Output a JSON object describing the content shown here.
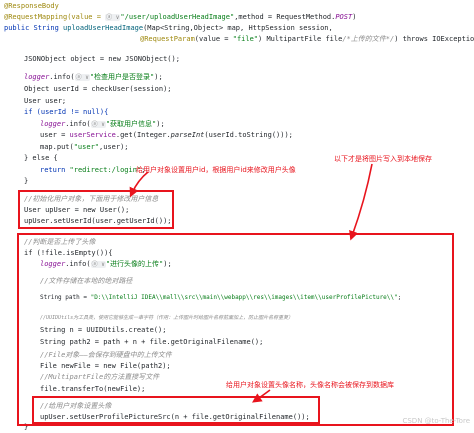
{
  "code": {
    "l01": "@ResponseBody",
    "l02a": "@RequestMapping(value = ",
    "l02b": "\"/user/uploadUserHeadImage\"",
    "l02c": ",method = RequestMethod.",
    "l02d": "POST",
    "l02e": ")",
    "l03a": "public String ",
    "l03b": "uploadUserHeadImage",
    "l03c": "(Map<String,Object> map, HttpSession session,",
    "l04a": "@RequestParam",
    "l04b": "(value = ",
    "l04c": "\"file\"",
    "l04d": ") MultipartFile file",
    "l04e": "/*上传的文件*/",
    "l04f": ") throws IOException {",
    "l05": "JSONObject object = new JSONObject();",
    "l06a": "logger",
    "l06b": ".info(",
    "l06c": "\"检查用户是否登录\"",
    "l06d": ");",
    "l07": "Object userId = checkUser(session);",
    "l08": "User user;",
    "l09": "if (userId != null){",
    "l10a": "logger",
    "l10b": ".info(",
    "l10c": "\"获取用户信息\"",
    "l10d": ");",
    "l11a": "user = ",
    "l11b": "userService",
    "l11c": ".get(Integer.",
    "l11d": "parseInt",
    "l11e": "(userId.toString()));",
    "l12a": "map.put(",
    "l12b": "\"user\"",
    "l12c": ",user);",
    "l13": "} else {",
    "l14a": "return ",
    "l14b": "\"redirect:/login\"",
    "l14c": ";",
    "l15": "}",
    "l16": "//初始化用户对象，下面用于修改用户信息",
    "l17": "User upUser = new User();",
    "l18": "upUser.setUserId(user.getUserId());",
    "l19": "//判断是否上传了头像",
    "l20": "if (!file.isEmpty()){",
    "l21a": "logger",
    "l21b": ".info(",
    "l21c": "\"进行头像的上传\"",
    "l21d": ");",
    "l22": "//文件存储在本地的绝对路径",
    "l23a": "String path = ",
    "l23b": "\"D:\\\\IntelliJ IDEA\\\\mall\\\\src\\\\main\\\\webapp\\\\res\\\\images\\\\item\\\\userProfilePicture\\\\\"",
    "l23c": ";",
    "l24": "//UUIDUtils为工具类，使用它能够生成一串字符（作用：上传图片时给图片名称前面加上，防止图片名称重复）",
    "l25": "String n = UUIDUtils.create();",
    "l26": "String path2 = path + n + file.getOriginalFilename();",
    "l27": "//File对象——会保存到硬盘中的上传文件",
    "l28": "File newFile = new File(path2);",
    "l29": "//MultipartFile的方法直接写文件",
    "l30": "file.transferTo(newFile);",
    "l31": "//给用户对象设置头像",
    "l32": "upUser.setUserProfilePictureSrc(n + file.getOriginalFilename());",
    "l33": "}"
  },
  "hints": {
    "h1": "ⓐ ∨",
    "h2": "ⓐ ∨"
  },
  "annotations": {
    "note1": "给用户对象设置用户id，根据用户id来修改用户头像",
    "note2": "以下才是将图片写入到本地保存",
    "note3": "给用户对象设置头像名称，头像名称会被保存到数据库",
    "color": "#e8141d"
  },
  "watermark": "CSDN @to-The-Tore"
}
